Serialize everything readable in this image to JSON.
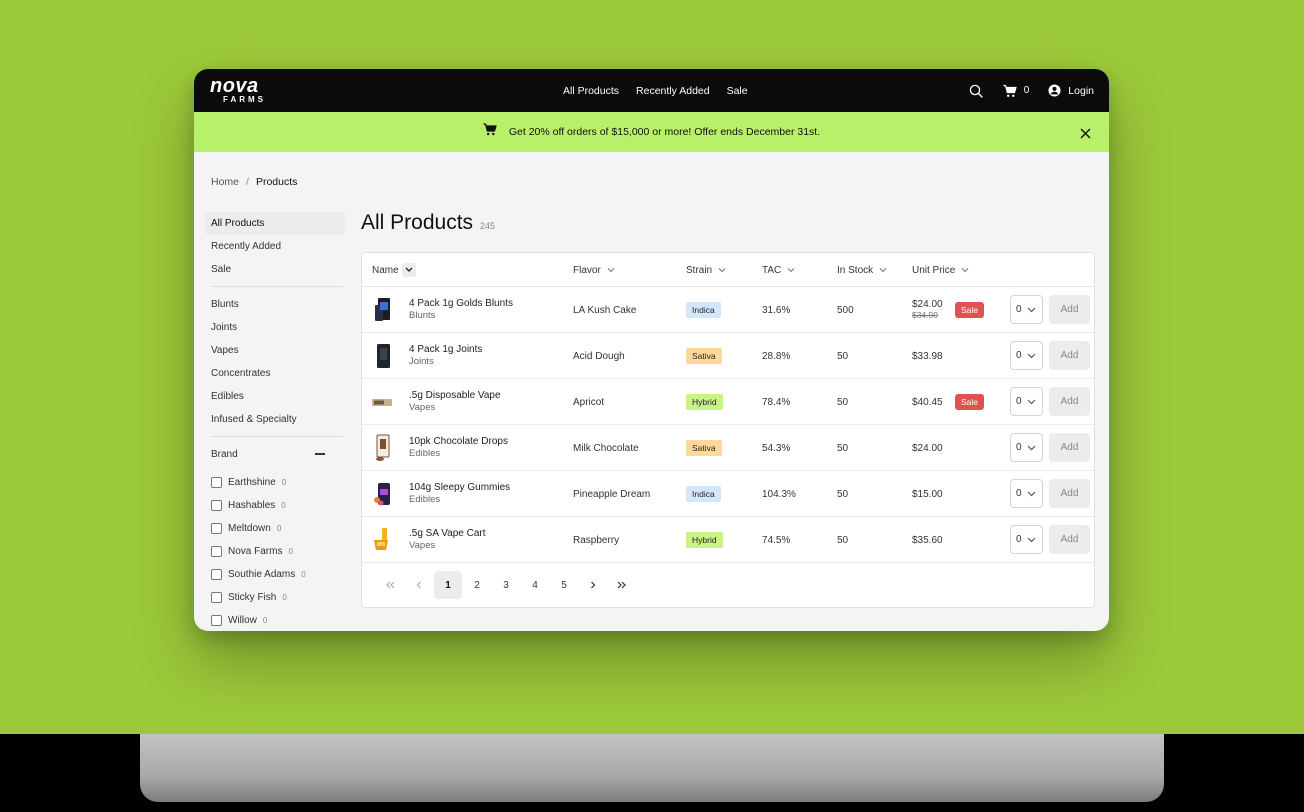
{
  "brand": {
    "logo_text": "nova",
    "logo_sub": "FARMS",
    "accent": "#9cd33b"
  },
  "nav": {
    "links": [
      "All Products",
      "Recently Added",
      "Sale"
    ],
    "cart_count": "0",
    "login": "Login"
  },
  "promo": {
    "message": "Get 20% off orders of $15,000 or more! Offer ends December 31st."
  },
  "breadcrumb": {
    "home": "Home",
    "sep": "/",
    "current": "Products"
  },
  "sidebar": {
    "top": [
      "All Products",
      "Recently Added",
      "Sale"
    ],
    "categories": [
      "Blunts",
      "Joints",
      "Vapes",
      "Concentrates",
      "Edibles",
      "Infused & Specialty"
    ],
    "brand_title": "Brand",
    "brands": [
      {
        "name": "Earthshine",
        "count": "0"
      },
      {
        "name": "Hashables",
        "count": "0"
      },
      {
        "name": "Meltdown",
        "count": "0"
      },
      {
        "name": "Nova Farms",
        "count": "0"
      },
      {
        "name": "Southie Adams",
        "count": "0"
      },
      {
        "name": "Sticky Fish",
        "count": "0"
      },
      {
        "name": "Willow",
        "count": "0"
      }
    ]
  },
  "main": {
    "title": "All Products",
    "count": "245"
  },
  "table": {
    "headers": [
      "Name",
      "Flavor",
      "Strain",
      "TAC",
      "In Stock",
      "Unit Price"
    ],
    "rows": [
      {
        "name": "4 Pack 1g Golds Blunts",
        "category": "Blunts",
        "flavor": "LA Kush Cake",
        "strain": "Indica",
        "tac": "31.6%",
        "stock": "500",
        "price": "$24.00",
        "old_price": "$34.00",
        "sale": "Sale",
        "qty": "0",
        "add": "Add"
      },
      {
        "name": "4 Pack 1g Joints",
        "category": "Joints",
        "flavor": "Acid Dough",
        "strain": "Sativa",
        "tac": "28.8%",
        "stock": "50",
        "price": "$33.98",
        "old_price": "",
        "sale": "",
        "qty": "0",
        "add": "Add"
      },
      {
        "name": ".5g Disposable Vape",
        "category": "Vapes",
        "flavor": "Apricot",
        "strain": "Hybrid",
        "tac": "78.4%",
        "stock": "50",
        "price": "$40.45",
        "old_price": "",
        "sale": "Sale",
        "qty": "0",
        "add": "Add"
      },
      {
        "name": "10pk Chocolate Drops",
        "category": "Edibles",
        "flavor": "Milk Chocolate",
        "strain": "Sativa",
        "tac": "54.3%",
        "stock": "50",
        "price": "$24.00",
        "old_price": "",
        "sale": "",
        "qty": "0",
        "add": "Add"
      },
      {
        "name": "104g Sleepy Gummies",
        "category": "Edibles",
        "flavor": "Pineapple Dream",
        "strain": "Indica",
        "tac": "104.3%",
        "stock": "50",
        "price": "$15.00",
        "old_price": "",
        "sale": "",
        "qty": "0",
        "add": "Add"
      },
      {
        "name": ".5g SA Vape Cart",
        "category": "Vapes",
        "flavor": "Raspberry",
        "strain": "Hybrid",
        "tac": "74.5%",
        "stock": "50",
        "price": "$35.60",
        "old_price": "",
        "sale": "",
        "qty": "0",
        "add": "Add"
      }
    ]
  },
  "pagination": {
    "pages": [
      "1",
      "2",
      "3",
      "4",
      "5"
    ],
    "current": "1"
  }
}
